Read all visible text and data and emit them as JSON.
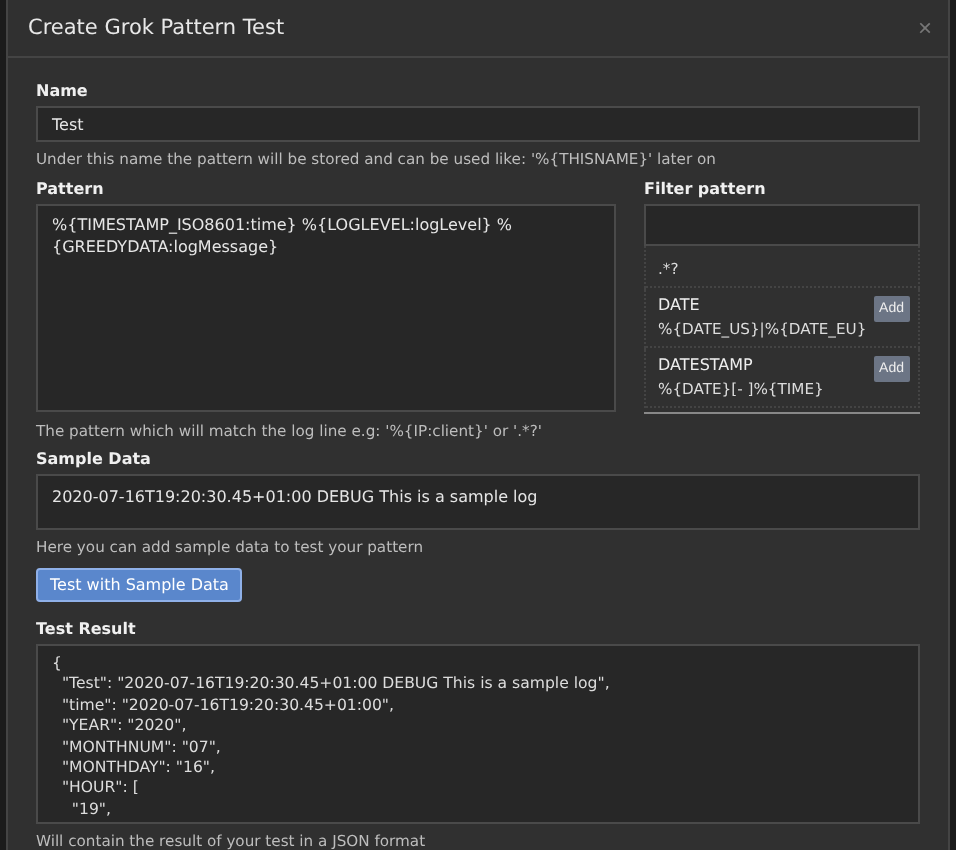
{
  "dialog": {
    "title": "Create Grok Pattern Test",
    "close": "×"
  },
  "name_field": {
    "label": "Name",
    "value": "Test",
    "help": "Under this name the pattern will be stored and can be used like: '%{THISNAME}' later on"
  },
  "pattern_field": {
    "label": "Pattern",
    "value": "%{TIMESTAMP_ISO8601:time} %{LOGLEVEL:logLevel} %{GREEDYDATA:logMessage}",
    "help": "The pattern which will match the log line e.g: '%{IP:client}' or '.*?'"
  },
  "filter": {
    "label": "Filter pattern",
    "items": [
      {
        "pattern": ".*?"
      },
      {
        "name": "DATE",
        "pattern": "%{DATE_US}|%{DATE_EU}",
        "add": "Add"
      },
      {
        "name": "DATESTAMP",
        "pattern": "%{DATE}[- ]%{TIME}",
        "add": "Add"
      }
    ]
  },
  "sample_field": {
    "label": "Sample Data",
    "value": "2020-07-16T19:20:30.45+01:00 DEBUG This is a sample log",
    "help": "Here you can add sample data to test your pattern"
  },
  "test_button": "Test with Sample Data",
  "result_field": {
    "label": "Test Result",
    "lines": [
      "{",
      "  \"Test\": \"2020-07-16T19:20:30.45+01:00 DEBUG This is a sample log\",",
      "  \"time\": \"2020-07-16T19:20:30.45+01:00\",",
      "  \"YEAR\": \"2020\",",
      "  \"MONTHNUM\": \"07\",",
      "  \"MONTHDAY\": \"16\",",
      "  \"HOUR\": [",
      "    \"19\","
    ],
    "help": "Will contain the result of your test in a JSON format"
  }
}
